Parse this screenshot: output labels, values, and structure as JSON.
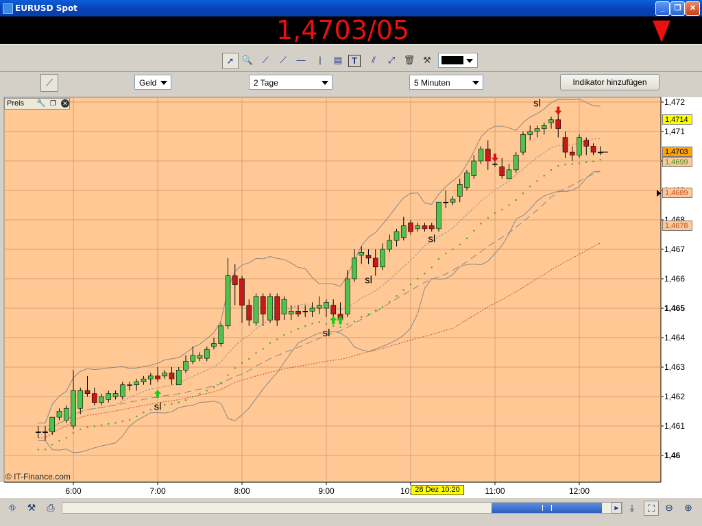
{
  "window": {
    "title": "EURUSD Spot",
    "minimize_label": "_",
    "restore_label": "❐",
    "close_label": "✕"
  },
  "price_bar": {
    "price": "1,4703/05",
    "direction": "down",
    "color": "#e81010"
  },
  "toolbar": {
    "tools": [
      "pointer-icon",
      "zoom-in-icon",
      "line-icon",
      "trend-line-icon",
      "horizontal-line-icon",
      "vertical-line-icon",
      "fibonacci-icon",
      "text-tool-icon",
      "parallel-lines-icon",
      "channel-icon",
      "trash-icon",
      "tools-icon"
    ],
    "color_swatch": "#000000"
  },
  "settings_bar": {
    "quote_type": "Geld",
    "period": "2 Tage",
    "interval": "5 Minuten",
    "add_indicator_label": "Indikator hinzufügen"
  },
  "panel": {
    "label": "Preis"
  },
  "watermark": "© IT-Finance.com",
  "crosshair_time_label": "28 Dez 10:20",
  "price_labels": [
    {
      "text": "1,4714",
      "bg": "#ffff00",
      "value": 1.4714
    },
    {
      "text": "1,4703",
      "bg": "#ffa500",
      "value": 1.4703
    },
    {
      "text": "1,4699",
      "bg": "#ffc894",
      "color": "#2b9a2b",
      "value": 1.46995
    },
    {
      "text": "1,4689",
      "bg": "#ffc894",
      "color": "#c05030",
      "value": 1.4689
    },
    {
      "text": "1,4678",
      "bg": "#ffc894",
      "color": "#c05030",
      "value": 1.4678
    }
  ],
  "annotations": [
    {
      "text": "sl",
      "time": "7:00",
      "price": 1.46155
    },
    {
      "text": "sl",
      "time": "9:00",
      "price": 1.46405
    },
    {
      "text": "sl",
      "time": "9:30",
      "price": 1.46585
    },
    {
      "text": "sl",
      "time": "10:15",
      "price": 1.46725
    },
    {
      "text": "sl",
      "time": "11:30",
      "price": 1.47185
    }
  ],
  "chart_data": {
    "type": "candlestick",
    "instrument": "EURUSD Spot",
    "xlim_hours": [
      5.1,
      12.95
    ],
    "ylim": [
      1.4595,
      1.4724
    ],
    "x_ticks": [
      "6:00",
      "7:00",
      "8:00",
      "9:00",
      "10:00",
      "11:00",
      "12:00"
    ],
    "y_ticks": [
      "1,472",
      "1,471",
      "1,470",
      "1,469",
      "1,468",
      "1,467",
      "1,466",
      "1,465",
      "1,464",
      "1,463",
      "1,462",
      "1,461",
      "1,46"
    ],
    "y_tick_values": [
      1.472,
      1.471,
      1.47,
      1.469,
      1.468,
      1.467,
      1.466,
      1.465,
      1.464,
      1.463,
      1.462,
      1.461,
      1.46
    ],
    "grid": true,
    "background": "#ffc894",
    "up_color": "#4ec24e",
    "down_color": "#c81818",
    "candles": [
      {
        "t": "5:35",
        "o": 1.4608,
        "h": 1.461,
        "l": 1.4606,
        "c": 1.4608
      },
      {
        "t": "5:40",
        "o": 1.4608,
        "h": 1.461,
        "l": 1.4605,
        "c": 1.4608
      },
      {
        "t": "5:45",
        "o": 1.4608,
        "h": 1.4613,
        "l": 1.4607,
        "c": 1.4613
      },
      {
        "t": "5:50",
        "o": 1.4613,
        "h": 1.4616,
        "l": 1.4612,
        "c": 1.4615
      },
      {
        "t": "5:55",
        "o": 1.4612,
        "h": 1.4617,
        "l": 1.4611,
        "c": 1.4616
      },
      {
        "t": "6:00",
        "o": 1.461,
        "h": 1.4629,
        "l": 1.4609,
        "c": 1.4622
      },
      {
        "t": "6:05",
        "o": 1.4616,
        "h": 1.4623,
        "l": 1.4614,
        "c": 1.4622
      },
      {
        "t": "6:10",
        "o": 1.4622,
        "h": 1.4627,
        "l": 1.462,
        "c": 1.4621
      },
      {
        "t": "6:15",
        "o": 1.4621,
        "h": 1.4623,
        "l": 1.4617,
        "c": 1.4618
      },
      {
        "t": "6:20",
        "o": 1.4618,
        "h": 1.4621,
        "l": 1.4617,
        "c": 1.462
      },
      {
        "t": "6:25",
        "o": 1.4619,
        "h": 1.4622,
        "l": 1.4618,
        "c": 1.4621
      },
      {
        "t": "6:30",
        "o": 1.462,
        "h": 1.4622,
        "l": 1.4619,
        "c": 1.4621
      },
      {
        "t": "6:35",
        "o": 1.462,
        "h": 1.4625,
        "l": 1.4619,
        "c": 1.4624
      },
      {
        "t": "6:40",
        "o": 1.4624,
        "h": 1.4625,
        "l": 1.4622,
        "c": 1.4624
      },
      {
        "t": "6:45",
        "o": 1.4624,
        "h": 1.4626,
        "l": 1.4622,
        "c": 1.4625
      },
      {
        "t": "6:50",
        "o": 1.4625,
        "h": 1.4627,
        "l": 1.4624,
        "c": 1.4626
      },
      {
        "t": "6:55",
        "o": 1.4626,
        "h": 1.4628,
        "l": 1.4624,
        "c": 1.4627
      },
      {
        "t": "7:00",
        "o": 1.4627,
        "h": 1.463,
        "l": 1.4625,
        "c": 1.4626
      },
      {
        "t": "7:05",
        "o": 1.4627,
        "h": 1.4629,
        "l": 1.4626,
        "c": 1.4628
      },
      {
        "t": "7:10",
        "o": 1.4628,
        "h": 1.463,
        "l": 1.4624,
        "c": 1.4626
      },
      {
        "t": "7:15",
        "o": 1.4624,
        "h": 1.463,
        "l": 1.4624,
        "c": 1.4629
      },
      {
        "t": "7:20",
        "o": 1.4629,
        "h": 1.4634,
        "l": 1.4628,
        "c": 1.4632
      },
      {
        "t": "7:25",
        "o": 1.4632,
        "h": 1.4637,
        "l": 1.4631,
        "c": 1.4634
      },
      {
        "t": "7:30",
        "o": 1.4633,
        "h": 1.4635,
        "l": 1.4632,
        "c": 1.4634
      },
      {
        "t": "7:35",
        "o": 1.4633,
        "h": 1.4637,
        "l": 1.4632,
        "c": 1.4636
      },
      {
        "t": "7:40",
        "o": 1.4637,
        "h": 1.464,
        "l": 1.4636,
        "c": 1.4638
      },
      {
        "t": "7:45",
        "o": 1.4638,
        "h": 1.4645,
        "l": 1.4637,
        "c": 1.4644
      },
      {
        "t": "7:50",
        "o": 1.4644,
        "h": 1.4667,
        "l": 1.4643,
        "c": 1.4661
      },
      {
        "t": "7:55",
        "o": 1.4661,
        "h": 1.4665,
        "l": 1.4651,
        "c": 1.4658
      },
      {
        "t": "8:00",
        "o": 1.466,
        "h": 1.4661,
        "l": 1.4645,
        "c": 1.4651
      },
      {
        "t": "8:05",
        "o": 1.4651,
        "h": 1.4653,
        "l": 1.4644,
        "c": 1.4646
      },
      {
        "t": "8:10",
        "o": 1.4645,
        "h": 1.4655,
        "l": 1.4644,
        "c": 1.4654
      },
      {
        "t": "8:15",
        "o": 1.4654,
        "h": 1.4655,
        "l": 1.4644,
        "c": 1.4648
      },
      {
        "t": "8:20",
        "o": 1.4646,
        "h": 1.4655,
        "l": 1.4645,
        "c": 1.4654
      },
      {
        "t": "8:25",
        "o": 1.4654,
        "h": 1.4655,
        "l": 1.4644,
        "c": 1.4646
      },
      {
        "t": "8:30",
        "o": 1.4648,
        "h": 1.4654,
        "l": 1.4646,
        "c": 1.4653
      },
      {
        "t": "8:35",
        "o": 1.4648,
        "h": 1.4651,
        "l": 1.4646,
        "c": 1.4649
      },
      {
        "t": "8:40",
        "o": 1.4649,
        "h": 1.4651,
        "l": 1.4647,
        "c": 1.4648
      },
      {
        "t": "8:45",
        "o": 1.4649,
        "h": 1.4651,
        "l": 1.4647,
        "c": 1.4649
      },
      {
        "t": "8:50",
        "o": 1.4649,
        "h": 1.4652,
        "l": 1.4647,
        "c": 1.465
      },
      {
        "t": "8:55",
        "o": 1.465,
        "h": 1.4654,
        "l": 1.4648,
        "c": 1.4651
      },
      {
        "t": "9:00",
        "o": 1.465,
        "h": 1.4653,
        "l": 1.4647,
        "c": 1.4652
      },
      {
        "t": "9:05",
        "o": 1.4651,
        "h": 1.4653,
        "l": 1.4647,
        "c": 1.4648
      },
      {
        "t": "9:10",
        "o": 1.4648,
        "h": 1.4652,
        "l": 1.4645,
        "c": 1.4646
      },
      {
        "t": "9:15",
        "o": 1.4648,
        "h": 1.4663,
        "l": 1.4647,
        "c": 1.466
      },
      {
        "t": "9:20",
        "o": 1.466,
        "h": 1.467,
        "l": 1.4659,
        "c": 1.4667
      },
      {
        "t": "9:25",
        "o": 1.4668,
        "h": 1.4671,
        "l": 1.4665,
        "c": 1.4669
      },
      {
        "t": "9:30",
        "o": 1.4668,
        "h": 1.467,
        "l": 1.4665,
        "c": 1.4667
      },
      {
        "t": "9:35",
        "o": 1.4667,
        "h": 1.467,
        "l": 1.4661,
        "c": 1.4664
      },
      {
        "t": "9:40",
        "o": 1.4664,
        "h": 1.4672,
        "l": 1.4663,
        "c": 1.467
      },
      {
        "t": "9:45",
        "o": 1.467,
        "h": 1.4675,
        "l": 1.4669,
        "c": 1.4673
      },
      {
        "t": "9:50",
        "o": 1.4673,
        "h": 1.4677,
        "l": 1.4671,
        "c": 1.4676
      },
      {
        "t": "9:55",
        "o": 1.4674,
        "h": 1.4681,
        "l": 1.4673,
        "c": 1.4678
      },
      {
        "t": "10:00",
        "o": 1.4679,
        "h": 1.468,
        "l": 1.4675,
        "c": 1.4676
      },
      {
        "t": "10:05",
        "o": 1.4677,
        "h": 1.4679,
        "l": 1.4676,
        "c": 1.4678
      },
      {
        "t": "10:10",
        "o": 1.4678,
        "h": 1.4679,
        "l": 1.4676,
        "c": 1.4677
      },
      {
        "t": "10:15",
        "o": 1.4678,
        "h": 1.4679,
        "l": 1.4676,
        "c": 1.4677
      },
      {
        "t": "10:20",
        "o": 1.4677,
        "h": 1.4686,
        "l": 1.4676,
        "c": 1.4686
      },
      {
        "t": "10:25",
        "o": 1.4686,
        "h": 1.469,
        "l": 1.4684,
        "c": 1.4686
      },
      {
        "t": "10:30",
        "o": 1.4686,
        "h": 1.4688,
        "l": 1.4685,
        "c": 1.4687
      },
      {
        "t": "10:35",
        "o": 1.4688,
        "h": 1.4694,
        "l": 1.4686,
        "c": 1.4692
      },
      {
        "t": "10:40",
        "o": 1.4691,
        "h": 1.4697,
        "l": 1.469,
        "c": 1.4696
      },
      {
        "t": "10:45",
        "o": 1.4695,
        "h": 1.4702,
        "l": 1.4694,
        "c": 1.47
      },
      {
        "t": "10:50",
        "o": 1.47,
        "h": 1.4705,
        "l": 1.4699,
        "c": 1.4704
      },
      {
        "t": "10:55",
        "o": 1.4704,
        "h": 1.4707,
        "l": 1.4697,
        "c": 1.47
      },
      {
        "t": "11:00",
        "o": 1.4699,
        "h": 1.4701,
        "l": 1.4698,
        "c": 1.4699
      },
      {
        "t": "11:05",
        "o": 1.4698,
        "h": 1.4701,
        "l": 1.4694,
        "c": 1.4695
      },
      {
        "t": "11:10",
        "o": 1.4694,
        "h": 1.4699,
        "l": 1.4695,
        "c": 1.4697
      },
      {
        "t": "11:15",
        "o": 1.4697,
        "h": 1.4703,
        "l": 1.4696,
        "c": 1.4702
      },
      {
        "t": "11:20",
        "o": 1.4703,
        "h": 1.471,
        "l": 1.4702,
        "c": 1.4709
      },
      {
        "t": "11:25",
        "o": 1.4709,
        "h": 1.4712,
        "l": 1.4707,
        "c": 1.471
      },
      {
        "t": "11:30",
        "o": 1.471,
        "h": 1.4712,
        "l": 1.4708,
        "c": 1.4711
      },
      {
        "t": "11:35",
        "o": 1.4711,
        "h": 1.4713,
        "l": 1.4709,
        "c": 1.4712
      },
      {
        "t": "11:40",
        "o": 1.4713,
        "h": 1.4715,
        "l": 1.4711,
        "c": 1.4714
      },
      {
        "t": "11:45",
        "o": 1.4714,
        "h": 1.4716,
        "l": 1.4708,
        "c": 1.4711
      },
      {
        "t": "11:50",
        "o": 1.4708,
        "h": 1.471,
        "l": 1.4701,
        "c": 1.4703
      },
      {
        "t": "11:55",
        "o": 1.4703,
        "h": 1.4705,
        "l": 1.47,
        "c": 1.4702
      },
      {
        "t": "12:00",
        "o": 1.4702,
        "h": 1.4709,
        "l": 1.4701,
        "c": 1.4708
      },
      {
        "t": "12:05",
        "o": 1.4707,
        "h": 1.4708,
        "l": 1.4702,
        "c": 1.4705
      },
      {
        "t": "12:10",
        "o": 1.4705,
        "h": 1.4706,
        "l": 1.4702,
        "c": 1.4703
      },
      {
        "t": "12:15",
        "o": 1.4703,
        "h": 1.4705,
        "l": 1.4702,
        "c": 1.4703
      }
    ],
    "signals": [
      {
        "time": "7:00",
        "type": "buy",
        "price": 1.462
      },
      {
        "time": "9:05",
        "type": "buy",
        "price": 1.4645
      },
      {
        "time": "9:10",
        "type": "buy",
        "price": 1.4645
      },
      {
        "time": "10:55",
        "type": "sell",
        "price": 1.4702
      },
      {
        "time": "11:00",
        "type": "sell",
        "price": 1.4702
      },
      {
        "time": "11:45",
        "type": "sell",
        "price": 1.4718
      }
    ]
  }
}
